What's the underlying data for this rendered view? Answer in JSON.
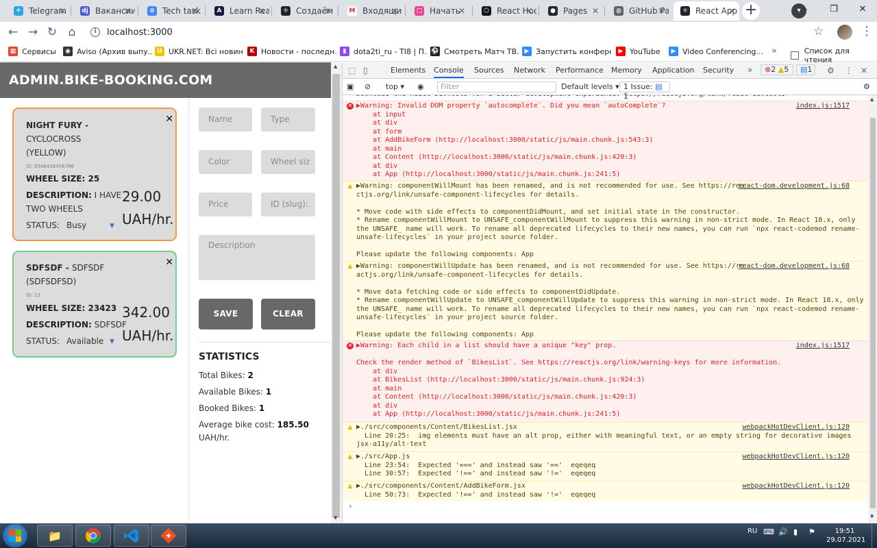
{
  "browser": {
    "tabs": [
      {
        "title": "Telegram",
        "icon": "telegram-icon",
        "color": "#2ca5e0",
        "glyph": "✈"
      },
      {
        "title": "Вакансии",
        "icon": "djinni-icon",
        "color": "#4a5bd4",
        "glyph": "dj"
      },
      {
        "title": "Tech task",
        "icon": "google-docs-icon",
        "color": "#4285f4",
        "glyph": "≡"
      },
      {
        "title": "Learn React",
        "icon": "codecademy-icon",
        "color": "#141c3a",
        "glyph": "A"
      },
      {
        "title": "Создаём",
        "icon": "react-icon",
        "color": "#20232a",
        "glyph": "⚛"
      },
      {
        "title": "Входящие",
        "icon": "gmail-icon",
        "color": "#ffffff",
        "glyph": "M"
      },
      {
        "title": "Начать",
        "icon": "figma-icon",
        "color": "#e84393",
        "glyph": "□"
      },
      {
        "title": "React Hooks",
        "icon": "codesandbox-icon",
        "color": "#151515",
        "glyph": "⬡"
      },
      {
        "title": "Pages",
        "icon": "github-icon",
        "color": "#24292e",
        "glyph": "●"
      },
      {
        "title": "GitHub Pages",
        "icon": "globe-icon",
        "color": "#5f6368",
        "glyph": "◍"
      },
      {
        "title": "React App",
        "icon": "react-icon",
        "color": "#20232a",
        "glyph": "⚛"
      }
    ],
    "newtab": "+",
    "window_buttons": [
      "–",
      "❐",
      "✕"
    ],
    "address": "localhost:3000",
    "bookmarks": [
      {
        "label": "Сервисы",
        "icon": "apps-grid-icon",
        "color": "#ea4335",
        "glyph": "▦"
      },
      {
        "label": "Aviso (Архив выпу...",
        "icon": "aviso-icon",
        "color": "#333333",
        "glyph": "◉"
      },
      {
        "label": "UKR.NET: Всі новин...",
        "icon": "ukrnet-icon",
        "color": "#f5c400",
        "glyph": "U"
      },
      {
        "label": "Новости - последн...",
        "icon": "news-icon",
        "color": "#c00000",
        "glyph": "K"
      },
      {
        "label": "dota2ti_ru - TI8 | П...",
        "icon": "twitch-icon",
        "color": "#9146ff",
        "glyph": "▮"
      },
      {
        "label": "Смотреть Матч ТВ...",
        "icon": "football-icon",
        "color": "#222222",
        "glyph": "⚽"
      },
      {
        "label": "Запустить конфере...",
        "icon": "zoom-icon",
        "color": "#2d8cff",
        "glyph": "▶"
      },
      {
        "label": "YouTube",
        "icon": "youtube-icon",
        "color": "#ff0000",
        "glyph": "▶"
      },
      {
        "label": "Video Conferencing...",
        "icon": "zoom-icon",
        "color": "#2d8cff",
        "glyph": "▶"
      }
    ],
    "bookmarks_more": "»",
    "reading_list": "Список для чтения"
  },
  "app": {
    "logo": "ADMIN.BIKE-BOOKING.COM",
    "bikes": [
      {
        "name": "NIGHT FURY",
        "type_line1": "CYCLOCROSS",
        "color_line": "(YELLOW)",
        "id": "ID: 6546456456786",
        "wheel_size": "WHEEL SIZE: 25",
        "desc_label": "DESCRIPTION:",
        "desc_line1": "I HAVE",
        "desc_line2": "TWO WHEELS",
        "price": "29.00",
        "price_unit": "UAH/hr.",
        "status_label": "STATUS:",
        "status_value": "Busy",
        "border_color": "#f29a3a"
      },
      {
        "name": "SDFSDF",
        "type_line1": "SDFSDF",
        "color_line": "(SDFSDFSD)",
        "id": "ID: 23",
        "wheel_size": "WHEEL SIZE: 23423",
        "desc_label": "DESCRIPTION:",
        "desc_line1": "SDFSDF",
        "desc_line2": "",
        "price": "342.00",
        "price_unit": "UAH/hr.",
        "status_label": "STATUS:",
        "status_value": "Available",
        "border_color": "#6fcf8a"
      }
    ],
    "form": {
      "name_placeholder": "Name",
      "type_placeholder": "Type",
      "color_placeholder": "Color",
      "wheel_placeholder": "Wheel siz",
      "price_placeholder": "Price",
      "id_placeholder": "ID (slug):",
      "description_placeholder": "Description",
      "save_label": "SAVE",
      "clear_label": "CLEAR"
    },
    "stats": {
      "title": "STATISTICS",
      "total_label": "Total Bikes:",
      "total_value": "2",
      "available_label": "Available Bikes:",
      "available_value": "1",
      "booked_label": "Booked Bikes:",
      "booked_value": "1",
      "avg_label": "Average bike cost:",
      "avg_value": "185.50",
      "avg_unit": "UAH/hr."
    }
  },
  "devtools": {
    "tabs": [
      "Elements",
      "Console",
      "Sources",
      "Network",
      "Performance",
      "Memory",
      "Application",
      "Security"
    ],
    "active_tab": "Console",
    "more": "»",
    "errors_count": "2",
    "warnings_count": "5",
    "info_count": "1",
    "context": "top",
    "filter_placeholder": "Filter",
    "levels": "Default levels",
    "issues": "1 Issue:",
    "issues_count": "1",
    "messages": [
      {
        "level": "info",
        "lines": [
          "Download the React DevTools for a better development experience: https://reactjs.org/link/react-devtools"
        ],
        "source": ""
      },
      {
        "level": "err",
        "lines": [
          "▶Warning: Invalid DOM property `autocomplete`. Did you mean `autoComplete`?",
          "    at input",
          "    at div",
          "    at form",
          "    at AddBikeForm (http://localhost:3000/static/js/main.chunk.js:543:3)",
          "    at main",
          "    at Content (http://localhost:3000/static/js/main.chunk.js:420:3)",
          "    at div",
          "    at App (http://localhost:3000/static/js/main.chunk.js:241:5)"
        ],
        "source": "index.js:1517"
      },
      {
        "level": "warn",
        "lines": [
          "▶Warning: componentWillMount has been renamed, and is not recommended for use. See https://rea",
          "ctjs.org/link/unsafe-component-lifecycles for details.",
          "",
          "* Move code with side effects to componentDidMount, and set initial state in the constructor.",
          "* Rename componentWillMount to UNSAFE_componentWillMount to suppress this warning in non-strict mode. In React 18.x, only",
          "the UNSAFE_ name will work. To rename all deprecated lifecycles to their new names, you can run `npx react-codemod rename-",
          "unsafe-lifecycles` in your project source folder.",
          "",
          "Please update the following components: App"
        ],
        "source": "react-dom.development.js:68"
      },
      {
        "level": "warn",
        "lines": [
          "▶Warning: componentWillUpdate has been renamed, and is not recommended for use. See https://re",
          "actjs.org/link/unsafe-component-lifecycles for details.",
          "",
          "* Move data fetching code or side effects to componentDidUpdate.",
          "* Rename componentWillUpdate to UNSAFE_componentWillUpdate to suppress this warning in non-strict mode. In React 18.x, only",
          "the UNSAFE_ name will work. To rename all deprecated lifecycles to their new names, you can run `npx react-codemod rename-",
          "unsafe-lifecycles` in your project source folder.",
          "",
          "Please update the following components: App"
        ],
        "source": "react-dom.development.js:68"
      },
      {
        "level": "err",
        "lines": [
          "▶Warning: Each child in a list should have a unique \"key\" prop.",
          "",
          "Check the render method of `BikesList`. See https://reactjs.org/link/warning-keys for more information.",
          "    at div",
          "    at BikesList (http://localhost:3000/static/js/main.chunk.js:924:3)",
          "    at main",
          "    at Content (http://localhost:3000/static/js/main.chunk.js:420:3)",
          "    at div",
          "    at App (http://localhost:3000/static/js/main.chunk.js:241:5)"
        ],
        "source": "index.js:1517"
      },
      {
        "level": "warn",
        "lines": [
          "▶./src/components/Content/BikesList.jsx",
          "  Line 20:25:  img elements must have an alt prop, either with meaningful text, or an empty string for decorative images",
          "jsx-a11y/alt-text"
        ],
        "source": "webpackHotDevClient.js:120"
      },
      {
        "level": "warn",
        "lines": [
          "▶./src/App.js",
          "  Line 23:54:  Expected '===' and instead saw '=='  eqeqeq",
          "  Line 30:57:  Expected '!==' and instead saw '!='  eqeqeq"
        ],
        "source": "webpackHotDevClient.js:120"
      },
      {
        "level": "warn",
        "lines": [
          "▶./src/components/Content/AddBikeForm.jsx",
          "  Line 50:73:  Expected '!==' and instead saw '!='  eqeqeq"
        ],
        "source": "webpackHotDevClient.js:120"
      }
    ],
    "prompt": "›"
  },
  "taskbar": {
    "lang": "RU",
    "time": "19:51",
    "date": "29.07.2021"
  }
}
